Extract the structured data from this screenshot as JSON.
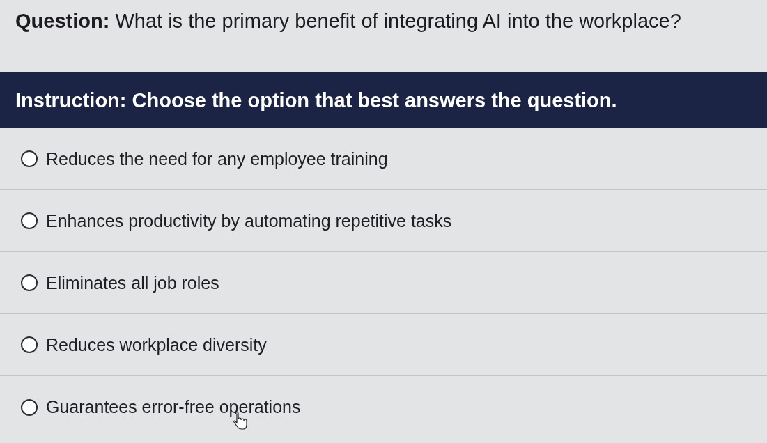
{
  "question": {
    "label": "Question:",
    "text": "What is the primary benefit of integrating AI into the workplace?"
  },
  "instruction": "Instruction: Choose the option that best answers the question.",
  "options": [
    {
      "label": "Reduces the need for any employee training",
      "selected": false
    },
    {
      "label": "Enhances productivity by automating repetitive tasks",
      "selected": false
    },
    {
      "label": "Eliminates all job roles",
      "selected": false
    },
    {
      "label": "Reduces workplace diversity",
      "selected": false
    },
    {
      "label": "Guarantees error-free operations",
      "selected": false
    }
  ]
}
